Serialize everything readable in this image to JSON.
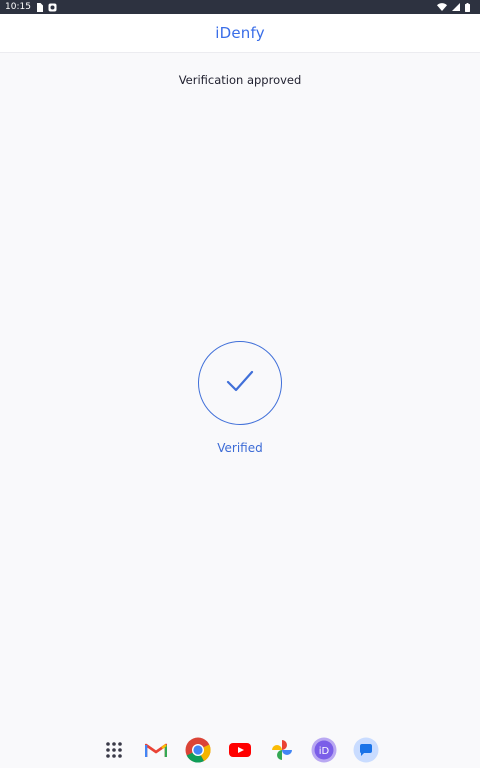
{
  "status_bar": {
    "time": "10:15",
    "icons": [
      "sim-card-icon",
      "notification-icon",
      "wifi-icon",
      "signal-icon",
      "battery-icon"
    ]
  },
  "header": {
    "logo_text": "iDenfy"
  },
  "main": {
    "title": "Verification approved",
    "status_label": "Verified",
    "icon": "checkmark-icon"
  },
  "colors": {
    "accent": "#3c6bd6",
    "background": "#f9f9fb",
    "status_bar": "#2d3240"
  },
  "dock": {
    "apps": [
      "app-drawer-icon",
      "gmail-icon",
      "chrome-icon",
      "youtube-icon",
      "photos-icon",
      "idenfy-icon",
      "messages-icon"
    ]
  }
}
